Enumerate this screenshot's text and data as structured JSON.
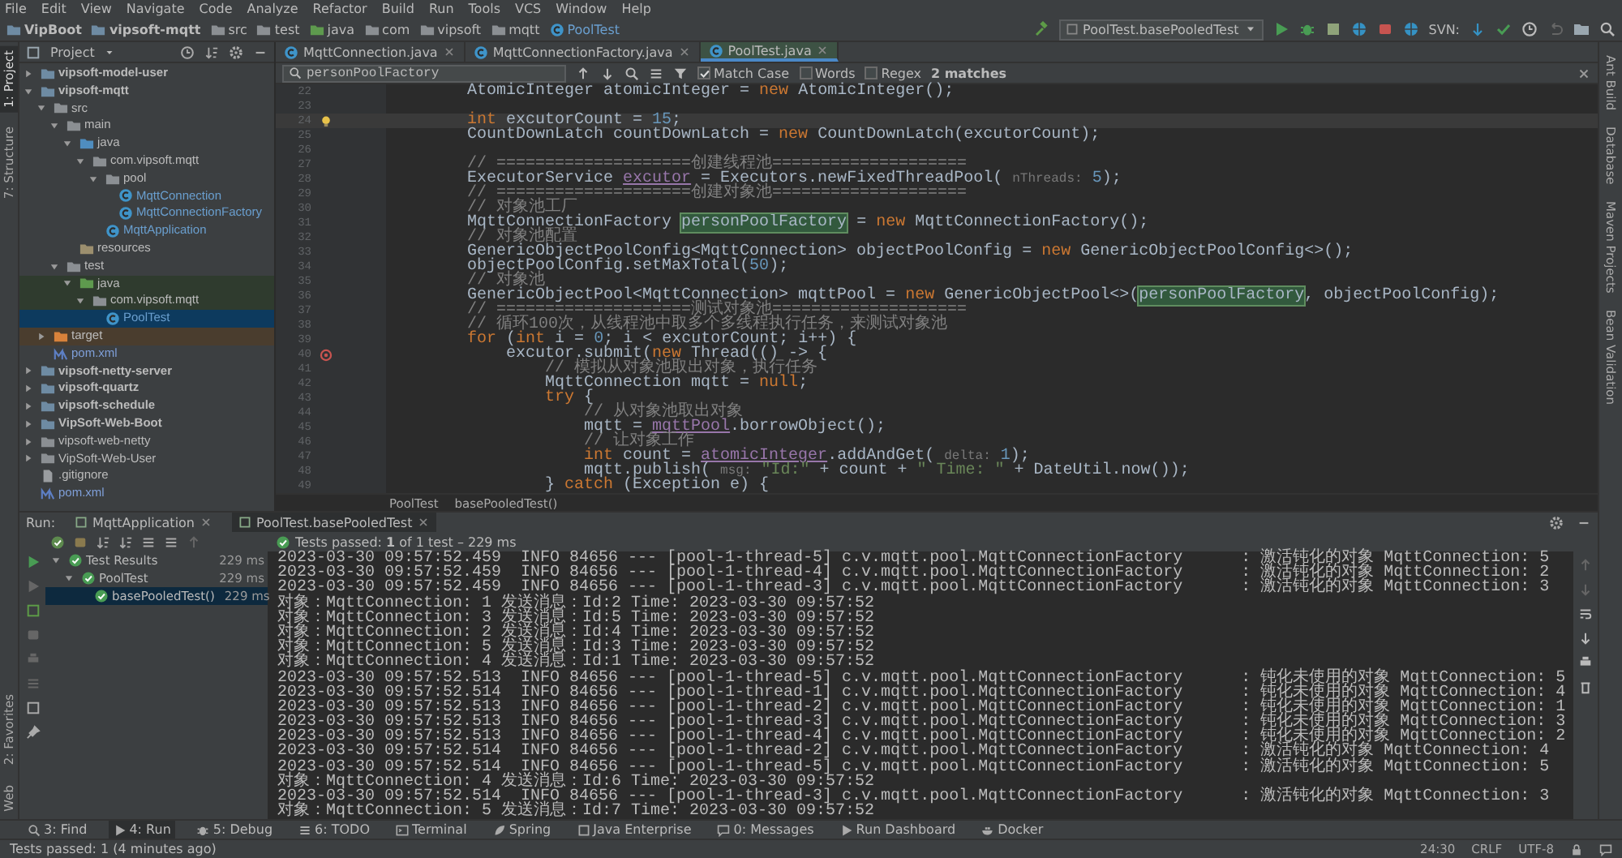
{
  "menu": [
    "File",
    "Edit",
    "View",
    "Navigate",
    "Code",
    "Analyze",
    "Refactor",
    "Build",
    "Run",
    "Tools",
    "VCS",
    "Window",
    "Help"
  ],
  "nav": {
    "crumbs": [
      {
        "label": "VipBoot",
        "kind": "module"
      },
      {
        "label": "vipsoft-mqtt",
        "kind": "module"
      },
      {
        "label": "src",
        "kind": "folder"
      },
      {
        "label": "test",
        "kind": "folder"
      },
      {
        "label": "java",
        "kind": "test-root"
      },
      {
        "label": "com",
        "kind": "package"
      },
      {
        "label": "vipsoft",
        "kind": "package"
      },
      {
        "label": "mqtt",
        "kind": "package"
      },
      {
        "label": "PoolTest",
        "kind": "class"
      }
    ],
    "run_config": "PoolTest.basePooledTest",
    "svn_label": "SVN:"
  },
  "left_strip_top": [
    {
      "label": "1: Project",
      "selected": true
    },
    {
      "label": "7: Structure",
      "selected": false
    }
  ],
  "left_strip_bottom": [
    {
      "label": "2: Favorites",
      "selected": false
    },
    {
      "label": "Web",
      "selected": false
    }
  ],
  "right_strip": [
    "Ant Build",
    "Database",
    "Maven Projects",
    "Bean Validation"
  ],
  "project": {
    "title": "Project",
    "tree": [
      {
        "label": "vipsoft-model-user",
        "kind": "module",
        "expanded": false,
        "selected": false
      },
      {
        "label": "vipsoft-mqtt",
        "kind": "module",
        "expanded": true,
        "selected": false,
        "children": [
          {
            "label": "src",
            "kind": "folder",
            "expanded": true,
            "selected": false,
            "children": [
              {
                "label": "main",
                "kind": "folder",
                "expanded": true,
                "selected": false,
                "children": [
                  {
                    "label": "java",
                    "kind": "source-root",
                    "expanded": true,
                    "selected": false,
                    "children": [
                      {
                        "label": "com.vipsoft.mqtt",
                        "kind": "package",
                        "expanded": true,
                        "selected": false,
                        "children": [
                          {
                            "label": "pool",
                            "kind": "package",
                            "expanded": true,
                            "selected": false,
                            "children": [
                              {
                                "label": "MqttConnection",
                                "kind": "class",
                                "selected": false
                              },
                              {
                                "label": "MqttConnectionFactory",
                                "kind": "class",
                                "selected": false
                              }
                            ]
                          },
                          {
                            "label": "MqttApplication",
                            "kind": "class",
                            "selected": false
                          }
                        ]
                      }
                    ]
                  },
                  {
                    "label": "resources",
                    "kind": "resources",
                    "selected": false
                  }
                ]
              },
              {
                "label": "test",
                "kind": "folder",
                "expanded": true,
                "selected": false,
                "children": [
                  {
                    "label": "java",
                    "kind": "test-root",
                    "expanded": true,
                    "selected": false,
                    "children": [
                      {
                        "label": "com.vipsoft.mqtt",
                        "kind": "test-package",
                        "expanded": true,
                        "selected": false,
                        "children": [
                          {
                            "label": "PoolTest",
                            "kind": "class",
                            "selected": true
                          }
                        ]
                      }
                    ]
                  }
                ]
              }
            ]
          },
          {
            "label": "target",
            "kind": "excluded",
            "expanded": false,
            "selected": false
          },
          {
            "label": "pom.xml",
            "kind": "maven",
            "selected": false
          }
        ]
      },
      {
        "label": "vipsoft-netty-server",
        "kind": "module",
        "expanded": false,
        "selected": false
      },
      {
        "label": "vipsoft-quartz",
        "kind": "module",
        "expanded": false,
        "selected": false
      },
      {
        "label": "vipsoft-schedule",
        "kind": "module",
        "expanded": false,
        "selected": false
      },
      {
        "label": "VipSoft-Web-Boot",
        "kind": "module",
        "expanded": false,
        "selected": false
      },
      {
        "label": "vipsoft-web-netty",
        "kind": "folder",
        "expanded": false,
        "selected": false
      },
      {
        "label": "VipSoft-Web-User",
        "kind": "folder",
        "expanded": false,
        "selected": false
      },
      {
        "label": ".gitignore",
        "kind": "file",
        "selected": false
      },
      {
        "label": "pom.xml",
        "kind": "maven",
        "selected": false
      }
    ]
  },
  "editor": {
    "tabs": [
      {
        "label": "MqttConnection.java",
        "selected": false
      },
      {
        "label": "MqttConnectionFactory.java",
        "selected": false
      },
      {
        "label": "PoolTest.java",
        "selected": true
      }
    ],
    "search": {
      "value": "personPoolFactory",
      "options": [
        {
          "label": "Match Case",
          "checked": true
        },
        {
          "label": "Words",
          "checked": false
        },
        {
          "label": "Regex",
          "checked": false
        }
      ],
      "result": "2 matches"
    },
    "lines": [
      {
        "number": "22",
        "current": false,
        "tokens": [
          {
            "kind": "plain",
            "text": "        AtomicInteger atomicInteger = "
          },
          {
            "kind": "keyword",
            "text": "new"
          },
          {
            "kind": "plain",
            "text": " AtomicInteger();"
          }
        ]
      },
      {
        "number": "23",
        "current": false
      },
      {
        "number": "24",
        "current": true,
        "gutter_icon": {
          "kind": "bulb"
        },
        "tokens": [
          {
            "kind": "keyword",
            "text": "        int"
          },
          {
            "kind": "plain",
            "text": " excutorCount = "
          },
          {
            "kind": "number",
            "text": "15"
          },
          {
            "kind": "plain",
            "text": ";"
          }
        ]
      },
      {
        "number": "25",
        "current": false,
        "tokens": [
          {
            "kind": "plain",
            "text": "        CountDownLatch countDownLatch = "
          },
          {
            "kind": "keyword",
            "text": "new"
          },
          {
            "kind": "plain",
            "text": " CountDownLatch(excutorCount);"
          }
        ]
      },
      {
        "number": "26",
        "current": false
      },
      {
        "number": "27",
        "current": false,
        "tokens": [
          {
            "kind": "comment",
            "text": "        // ====================创建线程池===================="
          }
        ]
      },
      {
        "number": "28",
        "current": false,
        "tokens": [
          {
            "kind": "plain",
            "text": "        ExecutorService "
          },
          {
            "kind": "field",
            "text": "excutor"
          },
          {
            "kind": "plain",
            "text": " = Executors.newFixedThreadPool( "
          },
          {
            "kind": "hint",
            "text": "nThreads:"
          },
          {
            "kind": "number",
            "text": " 5"
          },
          {
            "kind": "plain",
            "text": ");"
          }
        ]
      },
      {
        "number": "29",
        "current": false,
        "tokens": [
          {
            "kind": "comment",
            "text": "        // ====================创建对象池===================="
          }
        ]
      },
      {
        "number": "30",
        "current": false,
        "tokens": [
          {
            "kind": "comment",
            "text": "        // 对象池工厂"
          }
        ]
      },
      {
        "number": "31",
        "current": false,
        "tokens": [
          {
            "kind": "plain",
            "text": "        MqttConnectionFactory "
          },
          {
            "kind": "match",
            "text": "personPoolFactory"
          },
          {
            "kind": "plain",
            "text": " = "
          },
          {
            "kind": "keyword",
            "text": "new"
          },
          {
            "kind": "plain",
            "text": " MqttConnectionFactory();"
          }
        ]
      },
      {
        "number": "32",
        "current": false,
        "tokens": [
          {
            "kind": "comment",
            "text": "        // 对象池配置"
          }
        ]
      },
      {
        "number": "33",
        "current": false,
        "tokens": [
          {
            "kind": "plain",
            "text": "        GenericObjectPoolConfig<MqttConnection> objectPoolConfig = "
          },
          {
            "kind": "keyword",
            "text": "new"
          },
          {
            "kind": "plain",
            "text": " GenericObjectPoolConfig<>();"
          }
        ]
      },
      {
        "number": "34",
        "current": false,
        "tokens": [
          {
            "kind": "plain",
            "text": "        objectPoolConfig.setMaxTotal("
          },
          {
            "kind": "number",
            "text": "50"
          },
          {
            "kind": "plain",
            "text": ");"
          }
        ]
      },
      {
        "number": "35",
        "current": false,
        "tokens": [
          {
            "kind": "comment",
            "text": "        // 对象池"
          }
        ]
      },
      {
        "number": "36",
        "current": false,
        "tokens": [
          {
            "kind": "plain",
            "text": "        GenericObjectPool<MqttConnection> mqttPool = "
          },
          {
            "kind": "keyword",
            "text": "new"
          },
          {
            "kind": "plain",
            "text": " GenericObjectPool<>("
          },
          {
            "kind": "match",
            "text": "personPoolFactory"
          },
          {
            "kind": "plain",
            "text": ", objectPoolConfig);"
          }
        ]
      },
      {
        "number": "37",
        "current": false,
        "tokens": [
          {
            "kind": "comment",
            "text": "        // ====================测试对象池===================="
          }
        ]
      },
      {
        "number": "38",
        "current": false,
        "tokens": [
          {
            "kind": "comment",
            "text": "        // 循环100次，从线程池中取多个多线程执行任务，来测试对象池"
          }
        ]
      },
      {
        "number": "39",
        "current": false,
        "tokens": [
          {
            "kind": "keyword",
            "text": "        for"
          },
          {
            "kind": "plain",
            "text": " ("
          },
          {
            "kind": "keyword",
            "text": "int"
          },
          {
            "kind": "plain",
            "text": " i = "
          },
          {
            "kind": "number",
            "text": "0"
          },
          {
            "kind": "plain",
            "text": "; i < excutorCount; i++) {"
          }
        ]
      },
      {
        "number": "40",
        "current": false,
        "gutter_icon": {
          "kind": "lambda"
        },
        "tokens": [
          {
            "kind": "plain",
            "text": "            excutor.submit("
          },
          {
            "kind": "keyword",
            "text": "new"
          },
          {
            "kind": "plain",
            "text": " Thread(() -> {"
          }
        ]
      },
      {
        "number": "41",
        "current": false,
        "tokens": [
          {
            "kind": "comment",
            "text": "                // 模拟从对象池取出对象，执行任务"
          }
        ]
      },
      {
        "number": "42",
        "current": false,
        "tokens": [
          {
            "kind": "plain",
            "text": "                MqttConnection mqtt = "
          },
          {
            "kind": "keyword",
            "text": "null"
          },
          {
            "kind": "plain",
            "text": ";"
          }
        ]
      },
      {
        "number": "43",
        "current": false,
        "tokens": [
          {
            "kind": "keyword",
            "text": "                try"
          },
          {
            "kind": "plain",
            "text": " {"
          }
        ]
      },
      {
        "number": "44",
        "current": false,
        "tokens": [
          {
            "kind": "comment",
            "text": "                    // 从对象池取出对象"
          }
        ]
      },
      {
        "number": "45",
        "current": false,
        "tokens": [
          {
            "kind": "plain",
            "text": "                    mqtt = "
          },
          {
            "kind": "field",
            "text": "mqttPool"
          },
          {
            "kind": "plain",
            "text": ".borrowObject();"
          }
        ]
      },
      {
        "number": "46",
        "current": false,
        "tokens": [
          {
            "kind": "comment",
            "text": "                    // 让对象工作"
          }
        ]
      },
      {
        "number": "47",
        "current": false,
        "tokens": [
          {
            "kind": "keyword",
            "text": "                    int"
          },
          {
            "kind": "plain",
            "text": " count = "
          },
          {
            "kind": "field",
            "text": "atomicInteger"
          },
          {
            "kind": "plain",
            "text": ".addAndGet( "
          },
          {
            "kind": "hint",
            "text": "delta:"
          },
          {
            "kind": "number",
            "text": " 1"
          },
          {
            "kind": "plain",
            "text": ");"
          }
        ]
      },
      {
        "number": "48",
        "current": false,
        "tokens": [
          {
            "kind": "plain",
            "text": "                    mqtt.publish( "
          },
          {
            "kind": "hint",
            "text": "msg:"
          },
          {
            "kind": "string",
            "text": " \"Id:\""
          },
          {
            "kind": "plain",
            "text": " + count + "
          },
          {
            "kind": "string",
            "text": "\" Time: \""
          },
          {
            "kind": "plain",
            "text": " + DateUtil.now());"
          }
        ]
      },
      {
        "number": "49",
        "current": false,
        "tokens": [
          {
            "kind": "plain",
            "text": "                } "
          },
          {
            "kind": "keyword",
            "text": "catch"
          },
          {
            "kind": "plain",
            "text": " (Exception e) {"
          }
        ]
      }
    ],
    "breadcrumb": [
      "PoolTest",
      "basePooledTest()"
    ]
  },
  "run": {
    "label": "Run:",
    "tabs": [
      {
        "label": "MqttApplication",
        "selected": false
      },
      {
        "label": "PoolTest.basePooledTest",
        "selected": true
      }
    ],
    "summary": "Tests passed: **1** of 1 test – 229 ms",
    "results": [
      {
        "label": "Test Results",
        "time": "229 ms",
        "expanded": true,
        "selected": false,
        "children": [
          {
            "label": "PoolTest",
            "time": "229 ms",
            "expanded": true,
            "selected": false,
            "children": [
              {
                "label": "basePooledTest()",
                "time": "229 ms",
                "selected": true
              }
            ]
          }
        ]
      }
    ],
    "console": [
      "2023-03-30 09:57:52.459  INFO 84656 --- [pool-1-thread-5] c.v.mqtt.pool.MqttConnectionFactory      : 激活钝化的对象 MqttConnection: 5",
      "2023-03-30 09:57:52.459  INFO 84656 --- [pool-1-thread-4] c.v.mqtt.pool.MqttConnectionFactory      : 激活钝化的对象 MqttConnection: 2",
      "2023-03-30 09:57:52.459  INFO 84656 --- [pool-1-thread-3] c.v.mqtt.pool.MqttConnectionFactory      : 激活钝化的对象 MqttConnection: 3",
      "对象：MqttConnection: 1 发送消息：Id:2 Time: 2023-03-30 09:57:52",
      "对象：MqttConnection: 3 发送消息：Id:5 Time: 2023-03-30 09:57:52",
      "对象：MqttConnection: 2 发送消息：Id:4 Time: 2023-03-30 09:57:52",
      "对象：MqttConnection: 5 发送消息：Id:3 Time: 2023-03-30 09:57:52",
      "对象：MqttConnection: 4 发送消息：Id:1 Time: 2023-03-30 09:57:52",
      "2023-03-30 09:57:52.513  INFO 84656 --- [pool-1-thread-5] c.v.mqtt.pool.MqttConnectionFactory      : 钝化未使用的对象 MqttConnection: 5",
      "2023-03-30 09:57:52.514  INFO 84656 --- [pool-1-thread-1] c.v.mqtt.pool.MqttConnectionFactory      : 钝化未使用的对象 MqttConnection: 4",
      "2023-03-30 09:57:52.513  INFO 84656 --- [pool-1-thread-2] c.v.mqtt.pool.MqttConnectionFactory      : 钝化未使用的对象 MqttConnection: 1",
      "2023-03-30 09:57:52.513  INFO 84656 --- [pool-1-thread-3] c.v.mqtt.pool.MqttConnectionFactory      : 钝化未使用的对象 MqttConnection: 3",
      "2023-03-30 09:57:52.513  INFO 84656 --- [pool-1-thread-4] c.v.mqtt.pool.MqttConnectionFactory      : 钝化未使用的对象 MqttConnection: 2",
      "2023-03-30 09:57:52.514  INFO 84656 --- [pool-1-thread-2] c.v.mqtt.pool.MqttConnectionFactory      : 激活钝化的对象 MqttConnection: 4",
      "2023-03-30 09:57:52.514  INFO 84656 --- [pool-1-thread-5] c.v.mqtt.pool.MqttConnectionFactory      : 激活钝化的对象 MqttConnection: 5",
      "对象：MqttConnection: 4 发送消息：Id:6 Time: 2023-03-30 09:57:52",
      "2023-03-30 09:57:52.514  INFO 84656 --- [pool-1-thread-3] c.v.mqtt.pool.MqttConnectionFactory      : 激活钝化的对象 MqttConnection: 3",
      "对象：MqttConnection: 5 发送消息：Id:7 Time: 2023-03-30 09:57:52"
    ]
  },
  "bottom_tabs": [
    {
      "label": "3: Find",
      "selected": false
    },
    {
      "label": "4: Run",
      "selected": true
    },
    {
      "label": "5: Debug",
      "selected": false
    },
    {
      "label": "6: TODO",
      "selected": false
    },
    {
      "label": "Terminal",
      "selected": false
    },
    {
      "label": "Spring",
      "selected": false
    },
    {
      "label": "Java Enterprise",
      "selected": false
    },
    {
      "label": "0: Messages",
      "selected": false
    },
    {
      "label": "Run Dashboard",
      "selected": false
    },
    {
      "label": "Docker",
      "selected": false
    }
  ],
  "status_bar": {
    "message": "Tests passed: 1 (4 minutes ago)",
    "position": "24:30",
    "line_separator": "CRLF",
    "encoding": "UTF-8"
  }
}
